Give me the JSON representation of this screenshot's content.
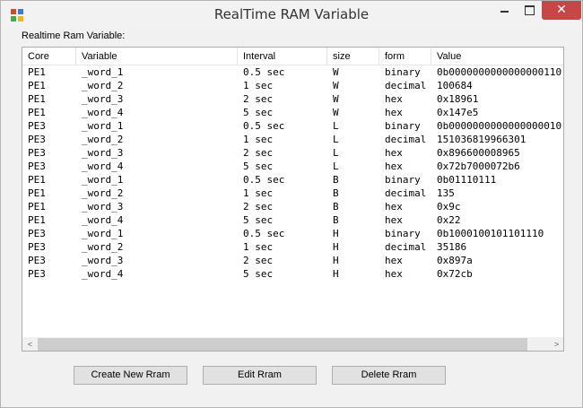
{
  "window": {
    "title": "RealTime RAM Variable",
    "close_glyph": "✕"
  },
  "group_label": "Realtime Ram Variable:",
  "table": {
    "columns": [
      "Core",
      "Variable",
      "Interval",
      "size",
      "form",
      "Value"
    ],
    "rows": [
      [
        "PE1",
        "_word_1",
        "0.5 sec",
        "W",
        "binary",
        "0b0000000000000000110"
      ],
      [
        "PE1",
        "_word_2",
        "1 sec",
        "W",
        "decimal",
        "100684"
      ],
      [
        "PE1",
        "_word_3",
        "2 sec",
        "W",
        "hex",
        "0x18961"
      ],
      [
        "PE1",
        "_word_4",
        "5 sec",
        "W",
        "hex",
        "0x147e5"
      ],
      [
        "PE3",
        "_word_1",
        "0.5 sec",
        "L",
        "binary",
        "0b0000000000000000010"
      ],
      [
        "PE3",
        "_word_2",
        "1 sec",
        "L",
        "decimal",
        "151036819966301"
      ],
      [
        "PE3",
        "_word_3",
        "2 sec",
        "L",
        "hex",
        "0x896600008965"
      ],
      [
        "PE3",
        "_word_4",
        "5 sec",
        "L",
        "hex",
        "0x72b7000072b6"
      ],
      [
        "PE1",
        "_word_1",
        "0.5 sec",
        "B",
        "binary",
        "0b01110111"
      ],
      [
        "PE1",
        "_word_2",
        "1 sec",
        "B",
        "decimal",
        "135"
      ],
      [
        "PE1",
        "_word_3",
        "2 sec",
        "B",
        "hex",
        "0x9c"
      ],
      [
        "PE1",
        "_word_4",
        "5 sec",
        "B",
        "hex",
        "0x22"
      ],
      [
        "PE3",
        "_word_1",
        "0.5 sec",
        "H",
        "binary",
        "0b1000100101101110"
      ],
      [
        "PE3",
        "_word_2",
        "1 sec",
        "H",
        "decimal",
        "35186"
      ],
      [
        "PE3",
        "_word_3",
        "2 sec",
        "H",
        "hex",
        "0x897a"
      ],
      [
        "PE3",
        "_word_4",
        "5 sec",
        "H",
        "hex",
        "0x72cb"
      ]
    ]
  },
  "scrollbar": {
    "left_arrow": "<",
    "right_arrow": ">"
  },
  "buttons": {
    "create": "Create New Rram",
    "edit": "Edit Rram",
    "delete": "Delete Rram"
  }
}
